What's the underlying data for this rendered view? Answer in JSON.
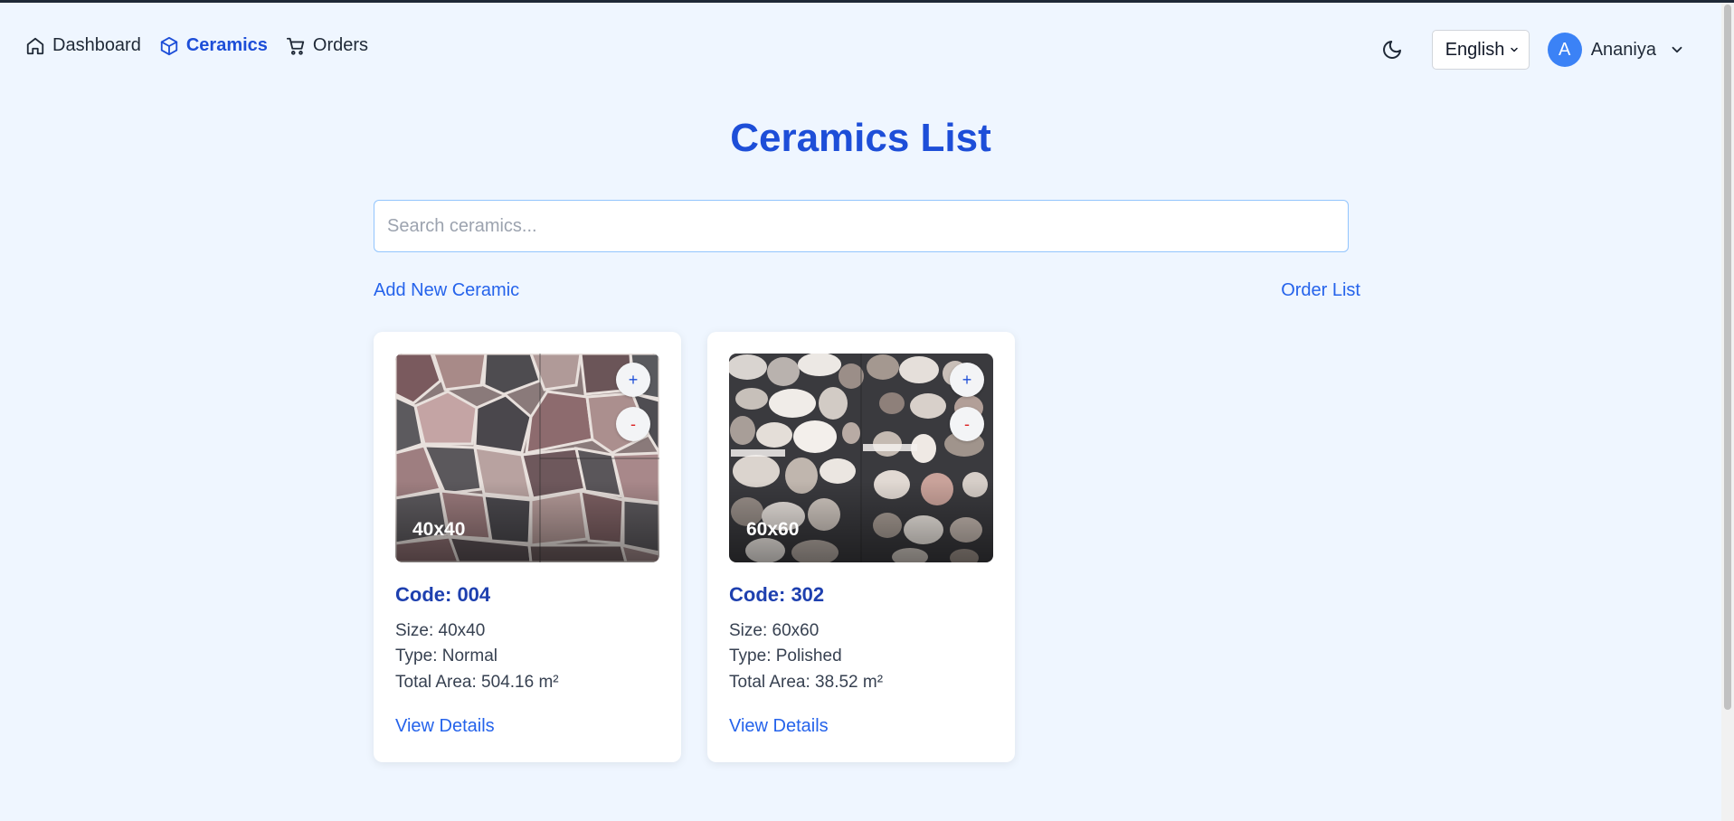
{
  "nav": {
    "items": [
      {
        "label": "Dashboard",
        "icon": "home-icon",
        "active": false
      },
      {
        "label": "Ceramics",
        "icon": "cube-icon",
        "active": true
      },
      {
        "label": "Orders",
        "icon": "cart-icon",
        "active": false
      }
    ],
    "language": "English",
    "user": {
      "initial": "A",
      "name": "Ananiya"
    }
  },
  "page": {
    "title": "Ceramics List",
    "search_placeholder": "Search ceramics...",
    "add_link": "Add New Ceramic",
    "order_link": "Order List"
  },
  "cards": [
    {
      "overlay": "40x40",
      "code": "Code: 004",
      "size": "Size: 40x40",
      "type": "Type: Normal",
      "area": "Total Area: 504.16 m²",
      "view": "View Details",
      "plus": "+",
      "minus": "-"
    },
    {
      "overlay": "60x60",
      "code": "Code: 302",
      "size": "Size: 60x60",
      "type": "Type: Polished",
      "area": "Total Area: 38.52 m²",
      "view": "View Details",
      "plus": "+",
      "minus": "-"
    }
  ],
  "colors": {
    "accent": "#1d4ed8",
    "link": "#2563eb",
    "background": "#eff6ff",
    "avatar": "#3b82f6",
    "minus": "#dc2626"
  }
}
